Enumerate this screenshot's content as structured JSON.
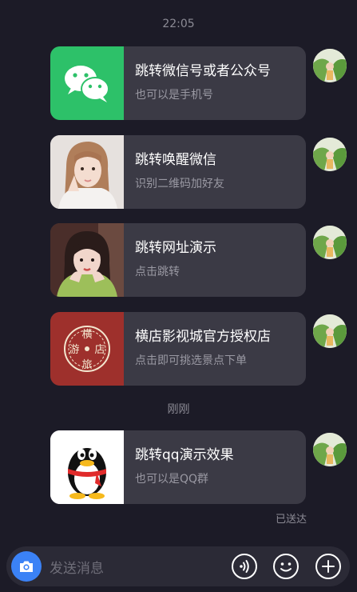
{
  "timestamps": {
    "first": "22:05",
    "second": "刚刚"
  },
  "cards": [
    {
      "title": "跳转微信号或者公众号",
      "subtitle": "也可以是手机号",
      "thumb": "wechat-logo"
    },
    {
      "title": "跳转唤醒微信",
      "subtitle": "识别二维码加好友",
      "thumb": "portrait-photo"
    },
    {
      "title": "跳转网址演示",
      "subtitle": "点击跳转",
      "thumb": "portrait-photo"
    },
    {
      "title": "横店影视城官方授权店",
      "subtitle": "点击即可挑选景点下单",
      "thumb": "hengdian-logo"
    },
    {
      "title": "跳转qq演示效果",
      "subtitle": "也可以是QQ群",
      "thumb": "qq-penguin-logo"
    }
  ],
  "hengdian_logo_text": [
    "横",
    "游",
    "店",
    "旅"
  ],
  "status": {
    "sent": "已送达"
  },
  "input": {
    "placeholder": "发送消息"
  },
  "colors": {
    "background": "#1c1b27",
    "bubble": "#3b3a45",
    "wechat_green": "#2dc169",
    "hengdian_red": "#9e302c",
    "accent_blue": "#3b82f6"
  }
}
